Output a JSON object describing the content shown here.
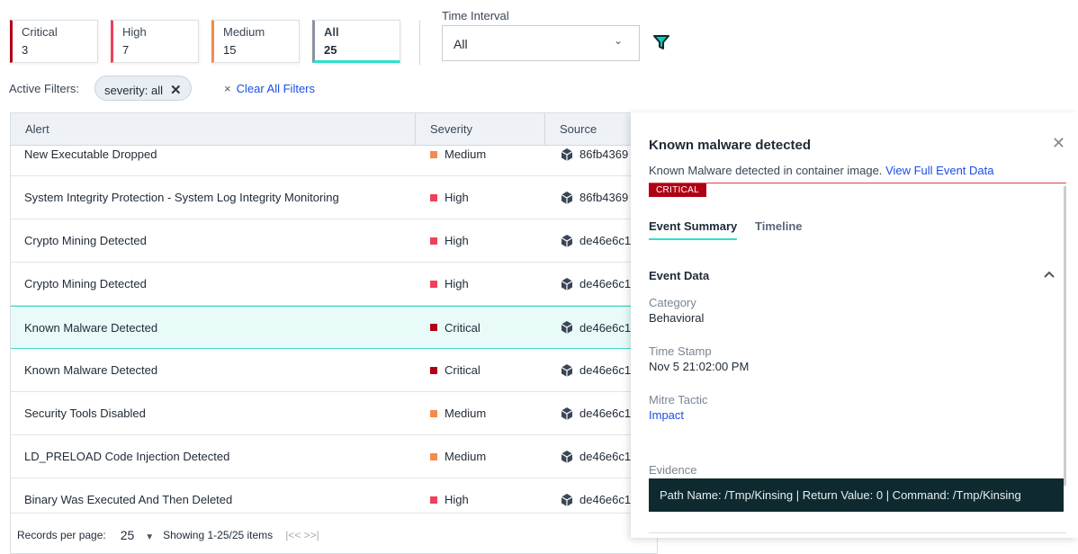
{
  "severity_cards": [
    {
      "label": "Critical",
      "count": "3",
      "color": "#b00016"
    },
    {
      "label": "High",
      "count": "7",
      "color": "#f0405a"
    },
    {
      "label": "Medium",
      "count": "15",
      "color": "#f58a4c"
    },
    {
      "label": "All",
      "count": "25",
      "color": "#8a93a0",
      "active_underline": "#2de0cc"
    }
  ],
  "time_interval": {
    "label": "Time Interval",
    "value": "All"
  },
  "filters": {
    "label": "Active Filters:",
    "chip": "severity: all",
    "clear": "Clear All Filters"
  },
  "table": {
    "headers": [
      "Alert",
      "Severity",
      "Source"
    ],
    "rows": [
      {
        "alert": "New Executable Dropped",
        "severity": "Medium",
        "source": "86fb4369"
      },
      {
        "alert": "System Integrity Protection - System Log Integrity Monitoring",
        "severity": "High",
        "source": "86fb4369"
      },
      {
        "alert": "Crypto Mining Detected",
        "severity": "High",
        "source": "de46e6c1"
      },
      {
        "alert": "Crypto Mining Detected",
        "severity": "High",
        "source": "de46e6c1"
      },
      {
        "alert": "Known Malware Detected",
        "severity": "Critical",
        "source": "de46e6c1",
        "selected": true
      },
      {
        "alert": "Known Malware Detected",
        "severity": "Critical",
        "source": "de46e6c1"
      },
      {
        "alert": "Security Tools Disabled",
        "severity": "Medium",
        "source": "de46e6c1"
      },
      {
        "alert": "LD_PRELOAD Code Injection Detected",
        "severity": "Medium",
        "source": "de46e6c1"
      },
      {
        "alert": "Binary Was Executed And Then Deleted",
        "severity": "High",
        "source": "de46e6c1"
      }
    ]
  },
  "footer": {
    "records_label": "Records per page:",
    "per_page": "25",
    "showing": "Showing 1-25/25 items",
    "pager": "|<< >>|"
  },
  "panel": {
    "title": "Known malware detected",
    "description": "Known Malware detected in container image.",
    "link": "View Full Event Data",
    "badge": "CRITICAL",
    "tabs": [
      "Event Summary",
      "Timeline"
    ],
    "section": "Event Data",
    "fields": [
      {
        "label": "Category",
        "value": "Behavioral"
      },
      {
        "label": "Time Stamp",
        "value": "Nov 5 21:02:00 PM"
      },
      {
        "label": "Mitre Tactic",
        "value": "Impact"
      }
    ],
    "evidence_label": "Evidence",
    "evidence": "Path Name: /Tmp/Kinsing | Return Value: 0 | Command: /Tmp/Kinsing"
  }
}
